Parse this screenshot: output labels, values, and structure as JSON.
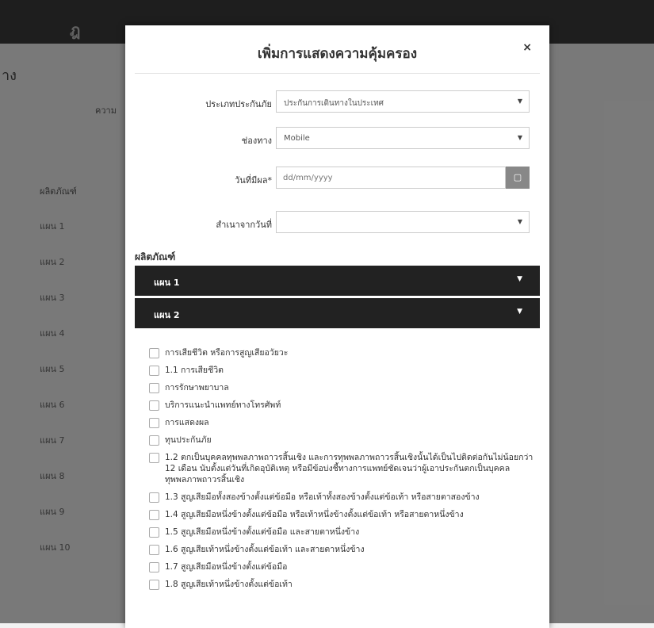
{
  "background": {
    "title": "าง",
    "subtitle": "ความ",
    "products_label": "ผลิตภัณฑ์",
    "plans": [
      "แผน 1",
      "แผน 2",
      "แผน 3",
      "แผน 4",
      "แผน 5",
      "แผน 6",
      "แผน 7",
      "แผน 8",
      "แผน 9",
      "แผน 10"
    ]
  },
  "modal": {
    "title": "เพิ่มการแสดงความคุ้มครอง",
    "close_label": "×",
    "fields": {
      "insurance_type": {
        "label": "ประเภทประกันภัย",
        "value": "ประกันการเดินทางในประเทศ"
      },
      "channel": {
        "label": "ช่องทาง",
        "value": "Mobile"
      },
      "effective_date": {
        "label": "วันที่มีผล*",
        "placeholder": "dd/mm/yyyy"
      },
      "copy_from_date": {
        "label": "สำเนาจากวันที่",
        "value": ""
      }
    },
    "products_label": "ผลิตภัณฑ์",
    "plans": [
      {
        "label": "แผน 1"
      },
      {
        "label": "แผน 2"
      }
    ],
    "coverage_items": [
      "การเสียชีวิต หรือการสูญเสียอวัยวะ",
      "1.1 การเสียชีวิต",
      "การรักษาพยาบาล",
      "บริการแนะนำแพทย์ทางโทรศัพท์",
      "การแสดงผล",
      "ทุนประกันภัย",
      "1.2 ตกเป็นบุคคลทุพพลภาพถาวรสิ้นเชิง และการทุพพลภาพถาวรสิ้นเชิงนั้นได้เป็นไปติดต่อกันไม่น้อยกว่า 12 เดือน นับตั้งแต่วันที่เกิดอุบัติเหตุ หรือมีข้อบ่งชี้ทางการแพทย์ชัดเจนว่าผู้เอาประกันตกเป็นบุคคล ทุพพลภาพถาวรสิ้นเชิง",
      "1.3 สูญเสียมือทั้งสองข้างตั้งแต่ข้อมือ หรือเท้าทั้งสองข้างตั้งแต่ข้อเท้า หรือสายตาสองข้าง",
      "1.4 สูญเสียมือหนึ่งข้างตั้งแต่ข้อมือ หรือเท้าหนึ่งข้างตั้งแต่ข้อเท้า หรือสายตาหนึ่งข้าง",
      "1.5 สูญเสียมือหนึ่งข้างตั้งแต่ข้อมือ และสายตาหนึ่งข้าง",
      "1.6 สูญเสียเท้าหนึ่งข้างตั้งแต่ข้อเท้า และสายตาหนึ่งข้าง",
      "1.7 สูญเสียมือหนึ่งข้างตั้งแต่ข้อมือ",
      "1.8 สูญเสียเท้าหนึ่งข้างตั้งแต่ข้อเท้า"
    ]
  }
}
